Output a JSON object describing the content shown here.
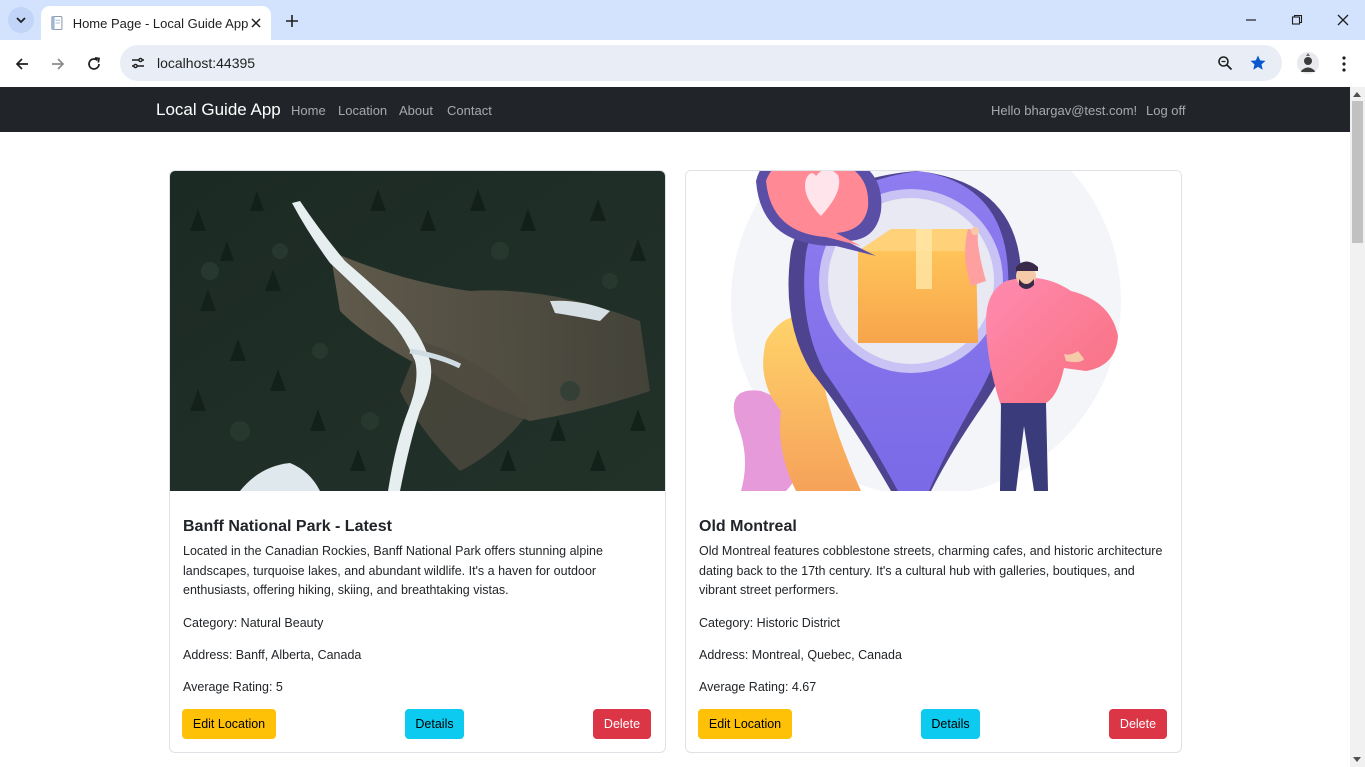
{
  "browser": {
    "tab_title": "Home Page - Local Guide App",
    "url": "localhost:44395",
    "accent_star": "#0b57d0"
  },
  "navbar": {
    "brand": "Local Guide App",
    "links": [
      "Home",
      "Location",
      "About",
      "Contact"
    ],
    "greeting": "Hello bhargav@test.com!",
    "logoff": "Log off"
  },
  "cards": [
    {
      "title": "Banff National Park - Latest",
      "description": "Located in the Canadian Rockies, Banff National Park offers stunning alpine landscapes, turquoise lakes, and abundant wildlife. It's a haven for outdoor enthusiasts, offering hiking, skiing, and breathtaking vistas.",
      "category": "Category: Natural Beauty",
      "address": "Address: Banff, Alberta, Canada",
      "rating": "Average Rating: 5",
      "edit_label": "Edit Location",
      "details_label": "Details",
      "delete_label": "Delete"
    },
    {
      "title": "Old Montreal",
      "description": "Old Montreal features cobblestone streets, charming cafes, and historic architecture dating back to the 17th century. It's a cultural hub with galleries, boutiques, and vibrant street performers.",
      "category": "Category: Historic District",
      "address": "Address: Montreal, Quebec, Canada",
      "rating": "Average Rating: 4.67",
      "edit_label": "Edit Location",
      "details_label": "Details",
      "delete_label": "Delete"
    }
  ],
  "colors": {
    "navbar_bg": "#212529",
    "edit_btn": "#ffc107",
    "details_btn": "#0dcaf0",
    "delete_btn": "#dc3545"
  }
}
